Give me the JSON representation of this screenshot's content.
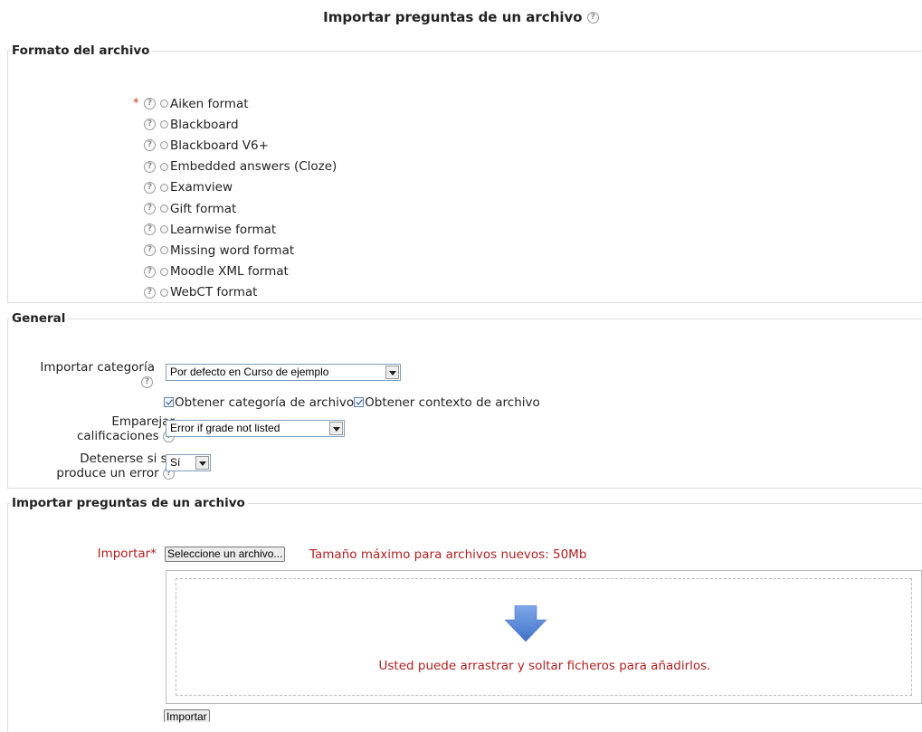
{
  "page": {
    "title": "Importar preguntas de un archivo",
    "help_icon": "?"
  },
  "sections": {
    "format": {
      "legend": "Formato del archivo",
      "required_mark": "*",
      "options": [
        "Aiken format",
        "Blackboard",
        "Blackboard V6+",
        "Embedded answers (Cloze)",
        "Examview",
        "Gift format",
        "Learnwise format",
        "Missing word format",
        "Moodle XML format",
        "WebCT format"
      ]
    },
    "general": {
      "legend": "General",
      "import_category_label": "Importar categoría",
      "import_category_value": "Por defecto en Curso de ejemplo",
      "from_file_category_label": "Obtener categoría de archivo",
      "from_file_context_label": "Obtener contexto de archivo",
      "match_grades_label_line1": "Emparejar",
      "match_grades_label_line2": "calificaciones",
      "match_grades_value": "Error if grade not listed",
      "stop_on_error_label_line1": "Detenerse si se",
      "stop_on_error_label_line2": "produce un error",
      "stop_on_error_value": "Sí"
    },
    "import": {
      "legend": "Importar preguntas de un archivo",
      "import_label": "Importar",
      "required_mark": "*",
      "choose_file_button": "Seleccione un archivo...",
      "max_size_text": "Tamaño máximo para archivos nuevos: 50Mb",
      "drop_text": "Usted puede arrastrar y soltar ficheros para añadirlos.",
      "submit_button": "Importar"
    }
  },
  "colors": {
    "required": "#b22020",
    "drop_arrow": "#5b8ad8",
    "fieldset_border": "#dddddd"
  },
  "icons": {
    "help": "question-circle-icon",
    "drop": "down-arrow-icon"
  }
}
